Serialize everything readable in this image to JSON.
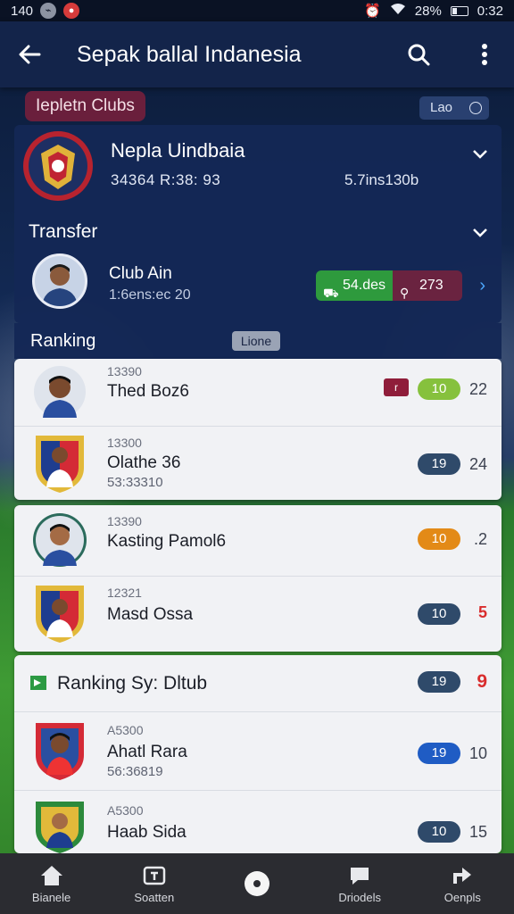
{
  "status_bar": {
    "time_left": "140",
    "battery_pct": "28%",
    "time_right": "0:32"
  },
  "app_bar": {
    "title": "Sepak ballal Indanesia"
  },
  "tags": {
    "primary": "Iepletn Clubs",
    "small": "Lao"
  },
  "club": {
    "name": "Nepla Uindbaia",
    "stats": "34364  R:38: 93",
    "extra": "5.7ins130b"
  },
  "transfer": {
    "section_label": "Transfer",
    "player_name": "Club Ain",
    "player_sub": "1:6ens:ec 20",
    "green_value": "54.des",
    "maroon_value": "273"
  },
  "ranking": {
    "label": "Ranking",
    "chip": "Lione"
  },
  "list_group_1": [
    {
      "meta": "13390",
      "name": "Thed Boz6",
      "sub": "",
      "score": "10",
      "score_color": "#86c13d",
      "value": "22",
      "value_red": false,
      "flag": true
    },
    {
      "meta": "13300",
      "name": "Olathe 36",
      "sub": "53:33310",
      "score": "19",
      "score_color": "#2f4a6a",
      "value": "24",
      "value_red": false,
      "flag": false
    }
  ],
  "list_group_2": [
    {
      "meta": "13390",
      "name": "Kasting Pamol6",
      "sub": "",
      "score": "10",
      "score_color": "#e38a17",
      "value": ".2",
      "value_red": false
    },
    {
      "meta": "12321",
      "name": "Masd Ossa",
      "sub": "",
      "score": "10",
      "score_color": "#2f4a6a",
      "value": "5",
      "value_red": true
    }
  ],
  "list_group_3": {
    "title": "Ranking Sy: Dltub",
    "title_score": "19",
    "title_value": "9",
    "rows": [
      {
        "meta": "A5300",
        "name": "Ahatl Rara",
        "sub": "56:36819",
        "score": "19",
        "score_color": "#1f5cc4",
        "value": "10",
        "value_red": false
      },
      {
        "meta": "A5300",
        "name": "Haab Sida",
        "sub": "",
        "score": "10",
        "score_color": "#2f4a6a",
        "value": "15",
        "value_red": false
      }
    ]
  },
  "bottom_nav": [
    {
      "label": "Bianele",
      "icon": "home-icon"
    },
    {
      "label": "Soatten",
      "icon": "tv-icon"
    },
    {
      "label": "",
      "icon": "record-icon"
    },
    {
      "label": "Driodels",
      "icon": "chat-icon"
    },
    {
      "label": "Oenpls",
      "icon": "share-icon"
    }
  ]
}
